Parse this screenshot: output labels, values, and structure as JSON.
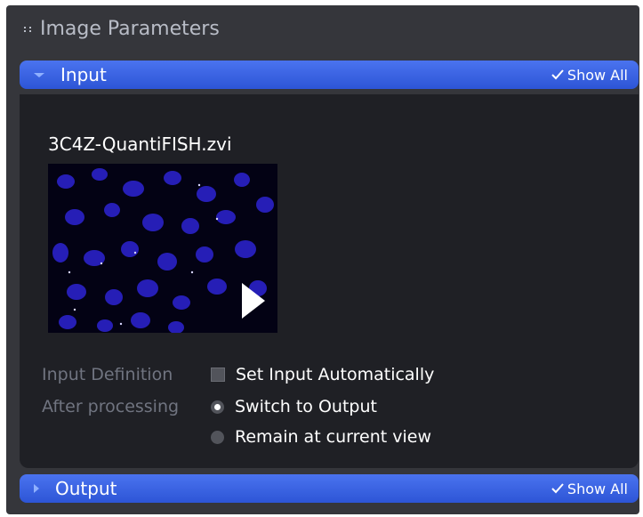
{
  "panel": {
    "title": "Image Parameters"
  },
  "input_section": {
    "title": "Input",
    "show_all_label": "Show All",
    "expanded": true,
    "file_name": "3C4Z-QuantiFISH.zvi"
  },
  "options": {
    "input_definition": {
      "label": "Input Definition",
      "checkbox_label": "Set Input Automatically",
      "checked": false
    },
    "after_processing": {
      "label": "After processing",
      "choices": [
        {
          "label": "Switch to Output",
          "selected": true
        },
        {
          "label": "Remain at current view",
          "selected": false
        }
      ]
    }
  },
  "output_section": {
    "title": "Output",
    "show_all_label": "Show All",
    "expanded": false
  },
  "colors": {
    "accent": "#3a62e4",
    "panel_bg": "#35363b",
    "body_bg": "#1f2025",
    "thumbnail_nuclei": "#2a22c8"
  },
  "icons": {
    "grip": "grip-icon",
    "expand": "chevron-down-icon",
    "collapse": "chevron-right-icon",
    "show_all": "checkmark-icon",
    "play": "play-icon"
  }
}
